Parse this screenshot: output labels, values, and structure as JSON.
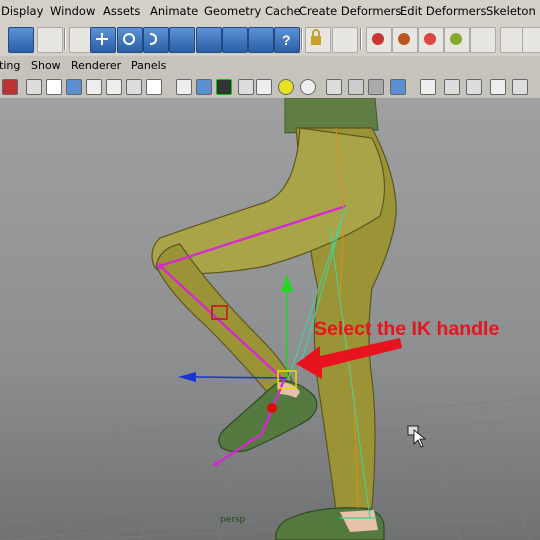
{
  "menubar": {
    "items": [
      "Display",
      "Window",
      "Assets",
      "Animate",
      "Geometry Cache",
      "Create Deformers",
      "Edit Deformers",
      "Skeleton"
    ]
  },
  "panel_menu": {
    "items": [
      "ting",
      "Show",
      "Renderer",
      "Panels"
    ]
  },
  "viewport": {
    "camera_label": "persp",
    "annotation": "Select the IK handle"
  },
  "colors": {
    "ui_background": "#d4d0c8",
    "viewport_top": "#9fa0a2",
    "leg_color": "#9a9436",
    "shoe_color": "#557a3f",
    "joint_color": "#d42bd0",
    "annotation_color": "#e8141d",
    "manipulator_y": "#20d620",
    "manipulator_x": "#1a34d6",
    "ik_handle_box": "#e8d800"
  },
  "icons": [
    "paint-select-icon",
    "lasso-icon",
    "move-icon",
    "rotate-icon",
    "snap-grid-icon",
    "snap-curve-icon",
    "snap-point-icon",
    "help-icon",
    "lock-icon",
    "render-icon",
    "ipr-render-icon",
    "render-settings-icon",
    "camera-icon",
    "wireframe-icon",
    "smooth-shade-icon",
    "texture-icon",
    "light-icon",
    "shadow-icon",
    "isolate-icon"
  ]
}
